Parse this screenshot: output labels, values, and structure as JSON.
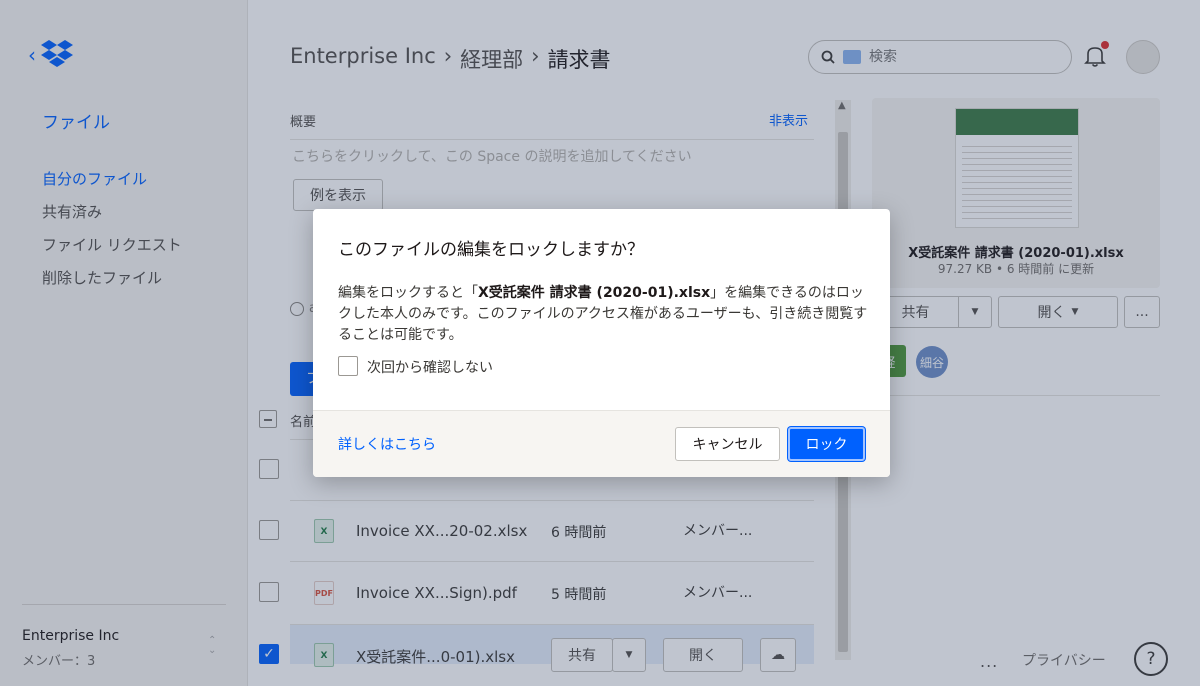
{
  "sidebar": {
    "section_title": "ファイル",
    "nav": [
      {
        "label": "自分のファイル"
      },
      {
        "label": "共有済み"
      },
      {
        "label": "ファイル リクエスト"
      },
      {
        "label": "削除したファイル"
      }
    ],
    "org_name": "Enterprise Inc",
    "members": "メンバー：3"
  },
  "header": {
    "breadcrumb": [
      "Enterprise Inc",
      "経理部",
      "請求書"
    ],
    "search_placeholder": "検索"
  },
  "overview": {
    "label": "概要",
    "hide_link": "非表示",
    "placeholder": "こちらをクリックして、この Space の説明を追加してください",
    "example_button": "例を表示",
    "activity_partial": "a"
  },
  "table": {
    "partial_button": "フ",
    "header_name": "名前",
    "rows": [
      {
        "name": "",
        "modified": "",
        "members": "",
        "icon": "",
        "checked": false
      },
      {
        "name": "Invoice XX...20-02.xlsx",
        "modified": "6 時間前",
        "members": "メンバー...",
        "icon": "X",
        "checked": false
      },
      {
        "name": "Invoice XX...Sign).pdf",
        "modified": "5 時間前",
        "members": "メンバー...",
        "icon": "PDF",
        "checked": false
      },
      {
        "name": "X受託案件...0-01).xlsx",
        "modified": "",
        "members": "",
        "icon": "X",
        "checked": true,
        "share": "共有",
        "open": "開く"
      }
    ]
  },
  "right_panel": {
    "file_name": "X受託案件 請求書 (2020-01).xlsx",
    "meta": "97.27 KB • 6 時間前 に更新",
    "share": "共有",
    "open": "開く",
    "more": "...",
    "tag_green": "経",
    "tag_avatar": "細谷"
  },
  "footer": {
    "more": "...",
    "privacy": "プライバシー",
    "help": "?"
  },
  "modal": {
    "title": "このファイルの編集をロックしますか？",
    "body_prefix": "編集をロックすると「",
    "body_file": "X受託案件 請求書 (2020-01).xlsx",
    "body_suffix": "」を編集できるのはロックした本人のみです。このファイルのアクセス権があるユーザーも、引き続き閲覧することは可能です。",
    "checkbox_label": "次回から確認しない",
    "learn_more": "詳しくはこちら",
    "cancel": "キャンセル",
    "lock": "ロック"
  },
  "colors": {
    "accent": "#0061fe",
    "overlay": "#2e4060",
    "tag_green": "#4f9a3a"
  }
}
